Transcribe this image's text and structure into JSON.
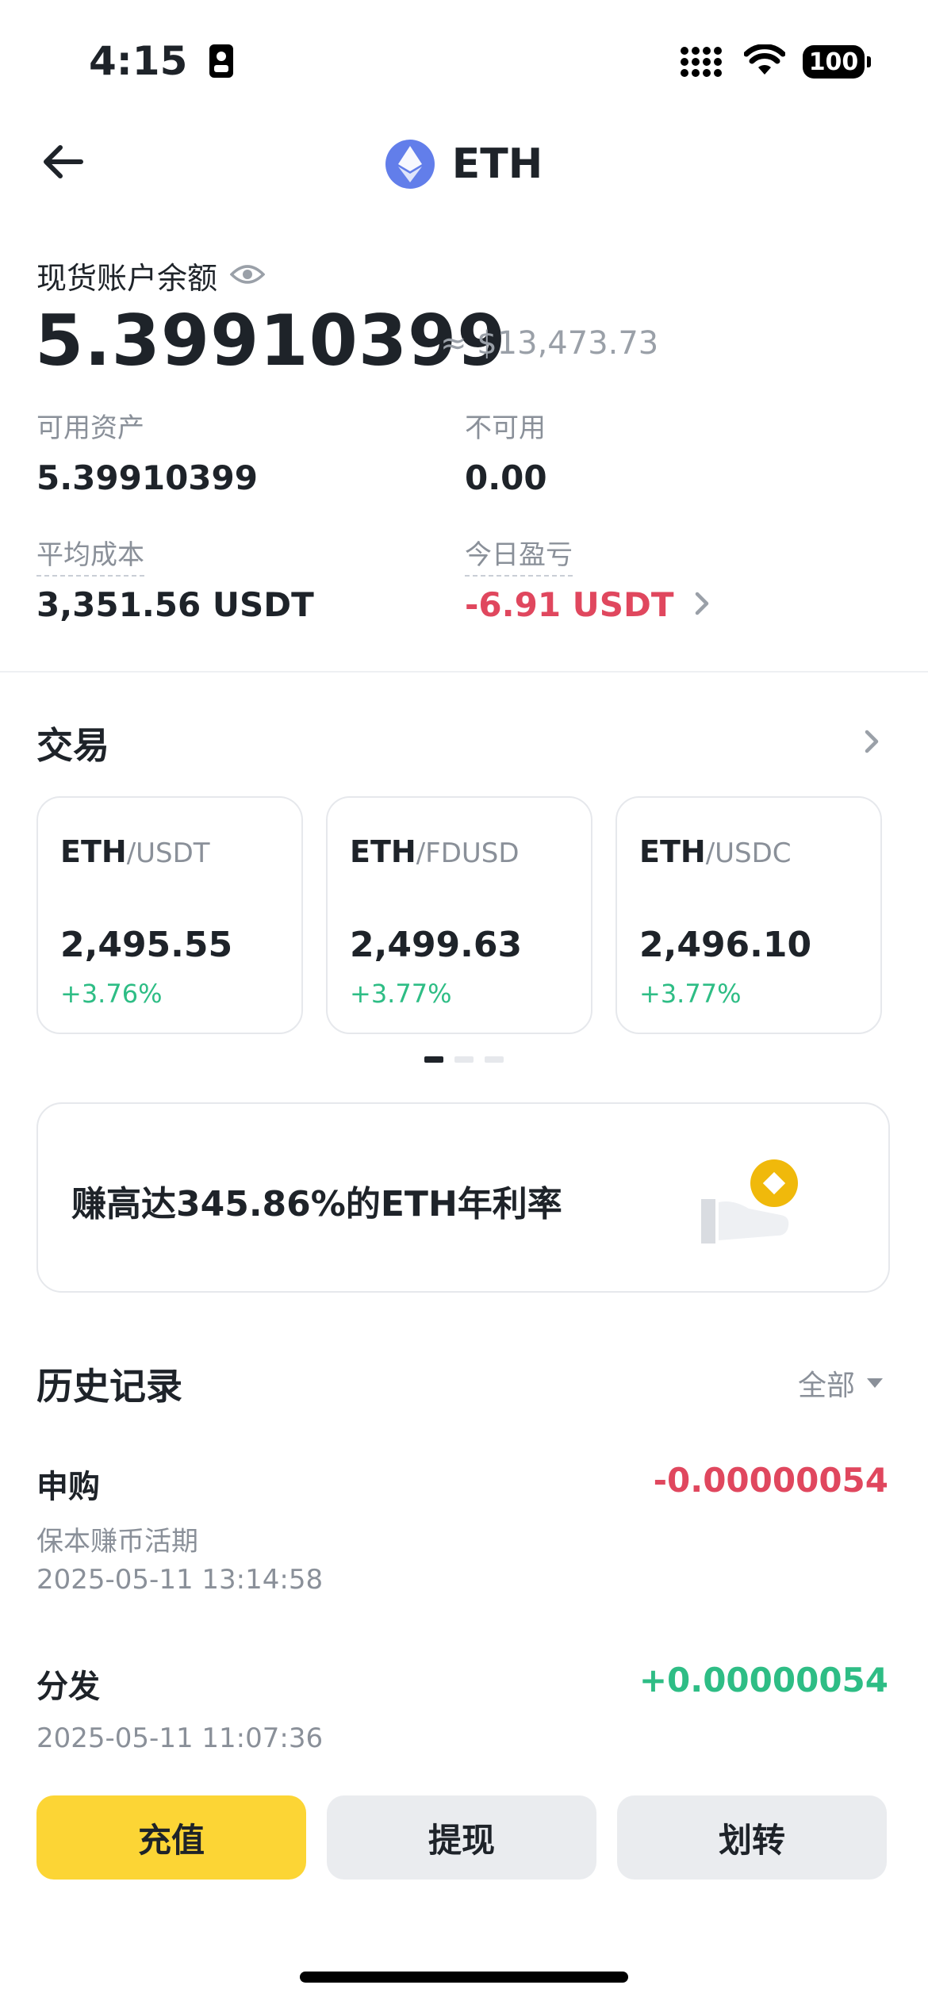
{
  "status_bar": {
    "time": "4:15",
    "battery": "100"
  },
  "header": {
    "title": "ETH",
    "icon": "ethereum-icon"
  },
  "balance": {
    "label": "现货账户余额",
    "amount": "5.39910399",
    "fiat": "≈ $13,473.73"
  },
  "stats": {
    "available_label": "可用资产",
    "available_value": "5.39910399",
    "unavailable_label": "不可用",
    "unavailable_value": "0.00",
    "avg_cost_label": "平均成本",
    "avg_cost_value": "3,351.56 USDT",
    "today_pnl_label": "今日盈亏",
    "today_pnl_value": "-6.91 USDT"
  },
  "trade": {
    "title": "交易",
    "pairs": [
      {
        "base": "ETH",
        "quote": "/USDT",
        "price": "2,495.55",
        "change": "+3.76%"
      },
      {
        "base": "ETH",
        "quote": "/FDUSD",
        "price": "2,499.63",
        "change": "+3.77%"
      },
      {
        "base": "ETH",
        "quote": "/USDC",
        "price": "2,496.10",
        "change": "+3.77%"
      }
    ]
  },
  "earn_banner": {
    "text": "赚高达345.86%的ETH年利率"
  },
  "history": {
    "title": "历史记录",
    "filter": "全部",
    "items": [
      {
        "type": "申购",
        "sub": "保本赚币活期",
        "time": "2025-05-11 13:14:58",
        "amount": "-0.00000054"
      },
      {
        "type": "分发",
        "time": "2025-05-11 11:07:36",
        "amount": "+0.00000054"
      }
    ]
  },
  "actions": {
    "deposit": "充值",
    "withdraw": "提现",
    "transfer": "划转"
  },
  "colors": {
    "accent_yellow": "#fcd535",
    "positive": "#2ebd85",
    "negative": "#e0475e",
    "eth": "#627eea"
  }
}
